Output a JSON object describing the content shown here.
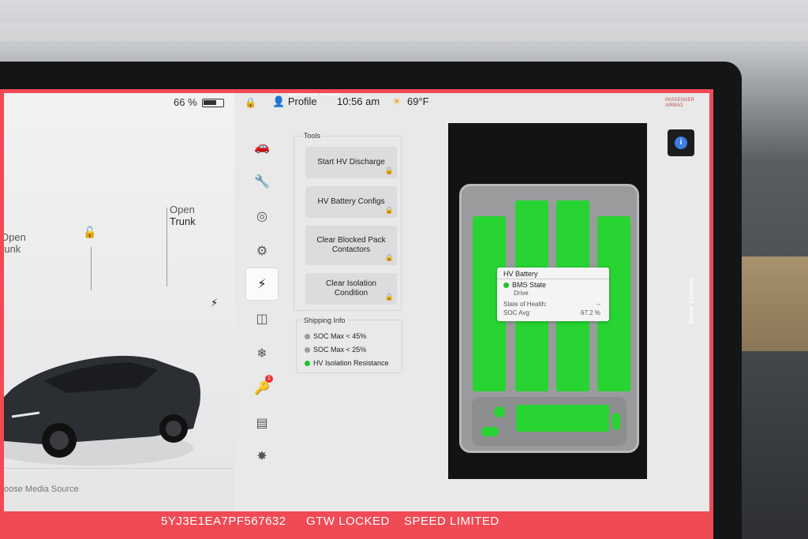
{
  "status": {
    "service_mode": "SERVICE MODE",
    "battery_pct": "66 %",
    "profile": "Profile",
    "time": "10:56 am",
    "temperature": "69°F",
    "airbag_line1": "PASSENGER",
    "airbag_line2": "AIRBAG"
  },
  "car": {
    "open_trunk_1": "Open",
    "open_trunk_2": "Trunk",
    "open_frunk_1": "Open",
    "open_frunk_2": "runk",
    "media_source": "oose Media Source"
  },
  "tools": {
    "section": "Tools",
    "start_hv_discharge": "Start HV Discharge",
    "hv_battery_configs": "HV Battery Configs",
    "clear_blocked_pack": "Clear Blocked Pack Contactors",
    "clear_isolation": "Clear Isolation Condition"
  },
  "shipping": {
    "section": "Shipping Info",
    "items": [
      {
        "label": "SOC Max < 45%",
        "color": "#9c9c9e"
      },
      {
        "label": "SOC Max < 25%",
        "color": "#9c9c9e"
      },
      {
        "label": "HV Isolation Resistance",
        "color": "#27c12f"
      }
    ]
  },
  "battery_tip": {
    "title": "HV Battery",
    "bms_label": "BMS State",
    "bms_value": "Drive",
    "soh_label": "State of Health:",
    "soh_value": "--",
    "soc_label": "SOC Avg:",
    "soc_value": "67.2 %"
  },
  "footer": {
    "vin": "5YJ3E1EA7PF567632",
    "gtw": "GTW LOCKED",
    "speed": "SPEED LIMITED"
  },
  "colors": {
    "accent": "#f04a55",
    "module_green": "#27d432"
  }
}
